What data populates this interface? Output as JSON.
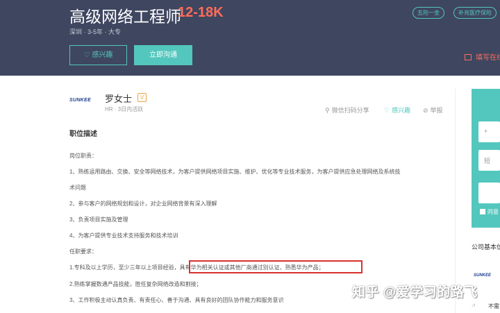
{
  "header": {
    "job_title": "高级网络工程师",
    "salary": "12-18K",
    "meta": "深圳 · 3-5年 · 大专",
    "tags": [
      "五险一金",
      "补充医疗保险"
    ],
    "interest_label": "♡ 感兴趣",
    "chat_label": "立即沟通",
    "resume_label": "填写在线"
  },
  "recruiter": {
    "logo_text": "SUNKEE",
    "name": "罗女士",
    "badge": "V",
    "info": "HR · 3日内活跃",
    "share_label": "微信扫码分享",
    "fav_label": "感兴趣",
    "report_label": "举报"
  },
  "description": {
    "title": "职位描述",
    "lines": [
      "岗位职责：",
      "1、熟练运用路由、交换、安全等网络技术，为客户提供网络项目实施、维护、优化等专业技术服务，为客户提供应急处理网络及系统技",
      "术问题",
      "2、参与客户的网络规划和设计，对企业网络背景有深入理解",
      "3、负责项目实施及管理",
      "4、为客户提供专业技术支持服务和技术培训",
      "任职要求：",
      "1.专科及以上学历，至少三年以上项目经验，具有华为相关认证或其他厂商通过别认证、熟悉华为产品；",
      "2.熟练掌握数通产品技能，胜任复杂网络改造和割接；",
      "3、工作积极主动认真负责、有责任心、善于沟通、具有良好的团队协作能力和服务意识"
    ]
  },
  "side": {
    "input1_icon": "+",
    "input2_icon": "短",
    "check_label": "同意",
    "company_title": "公司基本信",
    "company_logo": "SUNKEE",
    "company_more": "不需"
  },
  "watermark": "知乎 @爱学习的路飞",
  "colors": {
    "header_bg": "#3f4660",
    "accent": "#53c7bd",
    "salary": "#ff6d5a",
    "highlight": "#d9302e"
  }
}
